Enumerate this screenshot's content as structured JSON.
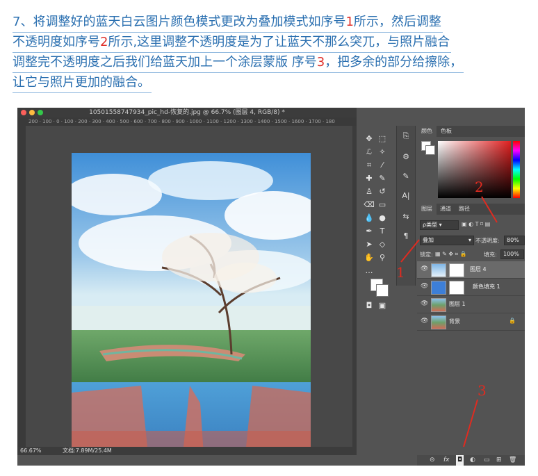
{
  "caption": {
    "line1_a": "7、将调整好的蓝天白云图片颜色模式更改为叠加模式如序号",
    "line1_num": "1",
    "line1_b": "所示，然后调整",
    "line2_a": "不透明度如序号",
    "line2_num": "2",
    "line2_b": "所示,这里调整不透明度是为了让蓝天不那么突兀，与照片融合",
    "line3_a": "调整完不透明度之后我们给蓝天加上一个涂层蒙版 序号",
    "line3_num": "3",
    "line3_b": "，把多余的部分给擦除，",
    "line4": "让它与照片更加的融合。"
  },
  "document": {
    "title": "10501558747934_pic_hd-恢复的.jpg @ 66.7% (图层 4, RGB/8) *",
    "ruler_ticks": "200 · 100 · 0 · 100 · 200 · 300 · 400 · 500 · 600 · 700 · 800 · 900 · 1000 · 1100 · 1200 · 1300 · 1400 · 1500 · 1600 · 1700 · 180",
    "zoom": "66.67%",
    "doc_size": "文档:7.89M/25.4M"
  },
  "color_panel": {
    "tab_color": "颜色",
    "tab_swatches": "色板"
  },
  "layers_panel": {
    "tab_layers": "图层",
    "tab_channels": "通道",
    "tab_paths": "路径",
    "filter_kind": "ρ类型",
    "blend_mode": "叠加",
    "opacity_label": "不透明度:",
    "opacity_value": "80%",
    "lock_label": "锁定:",
    "fill_label": "填充:",
    "fill_value": "100%",
    "layers": [
      {
        "name": "图层 4"
      },
      {
        "name": "颜色填充 1"
      },
      {
        "name": "图层 1"
      },
      {
        "name": "背景"
      }
    ]
  },
  "annotations": {
    "n1": "1",
    "n2": "2",
    "n3": "3"
  },
  "colors": {
    "caption_blue": "#2a6fb0",
    "annotation_red": "#e02b20",
    "ps_gray": "#535353"
  }
}
